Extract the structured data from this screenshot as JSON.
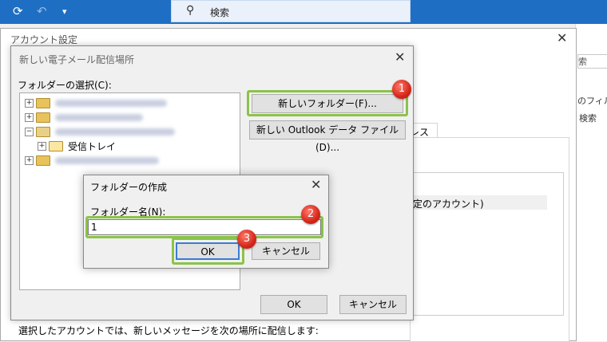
{
  "titlebar": {
    "search_label": "検索",
    "icons": [
      "refresh-icon",
      "undo-icon",
      "dropdown-icon",
      "search-icon"
    ]
  },
  "background": {
    "right_fragments": [
      "索",
      "のフィルタ",
      "検索"
    ]
  },
  "account_settings": {
    "title": "アカウント設定",
    "tab_fragment": "レス帳",
    "list_fragment": "定のアカウント)",
    "bottom_text": "選択したアカウントでは、新しいメッセージを次の場所に配信します:"
  },
  "delivery_dialog": {
    "title": "新しい電子メール配信場所",
    "folder_select_label": "フォルダーの選択(C):",
    "inbox_label": "受信トレイ",
    "new_folder_button": "新しいフォルダー(F)...",
    "new_outlook_button": "新しい Outlook データ ファイル(D)...",
    "ok_button": "OK",
    "cancel_button": "キャンセル"
  },
  "create_folder_dialog": {
    "title": "フォルダーの作成",
    "name_label": "フォルダー名(N):",
    "name_value": "1",
    "ok_button": "OK",
    "cancel_button": "キャンセル"
  },
  "badges": [
    "1",
    "2",
    "3"
  ],
  "colors": {
    "accent": "#1e6fc4",
    "highlight": "#8bc34a",
    "badge": "#d6261b"
  }
}
